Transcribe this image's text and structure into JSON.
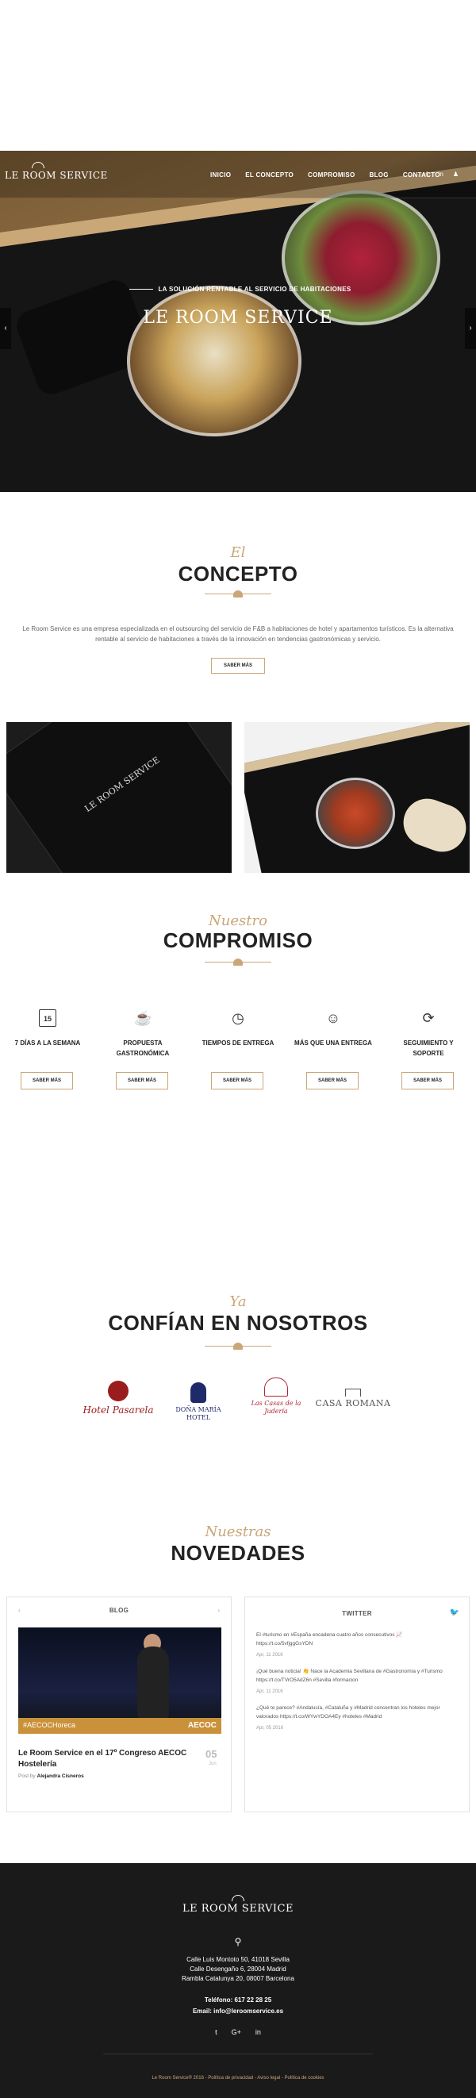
{
  "nav": {
    "logo": "LE ROOM SERVICE",
    "menu": [
      "INICIO",
      "EL CONCEPTO",
      "COMPROMISO",
      "BLOG",
      "CONTACTO"
    ]
  },
  "hero": {
    "subtitle": "LA SOLUCIÓN RENTABLE AL SERVICIO DE HABITACIONES",
    "title": "LE ROOM SERVICE"
  },
  "concepto": {
    "script": "El",
    "title": "CONCEPTO",
    "text": "Le Room Service es una empresa especializada en el outsourcing del servicio de F&B a habitaciones de hotel y apartamentos turísticos. Es la alternativa rentable al servicio de habitaciones a través de la innovación en tendencias gastronómicas y servicio.",
    "button": "SABER MÁS"
  },
  "photos": {
    "left_text": "LE ROOM SERVICE"
  },
  "compromiso": {
    "script": "Nuestro",
    "title": "COMPROMISO",
    "items": [
      {
        "label": "7 DÍAS A LA SEMANA",
        "icon": "calendar-icon",
        "glyph": "15",
        "button": "SABER MÁS"
      },
      {
        "label": "PROPUESTA GASTRONÓMICA",
        "icon": "coffee-icon",
        "glyph": "☕",
        "button": "SABER MÁS"
      },
      {
        "label": "TIEMPOS DE ENTREGA",
        "icon": "clock-icon",
        "glyph": "◷",
        "button": "SABER MÁS"
      },
      {
        "label": "MÁS QUE UNA ENTREGA",
        "icon": "smile-icon",
        "glyph": "☺",
        "button": "SABER MÁS"
      },
      {
        "label": "SEGUIMIENTO Y SOPORTE",
        "icon": "refresh-icon",
        "glyph": "⟳",
        "button": "SABER MÁS"
      }
    ]
  },
  "confian": {
    "script": "Ya",
    "title": "CONFÍAN EN NOSOTROS",
    "logos": [
      {
        "name": "Hotel Pasarela",
        "color": "#9b1c1c"
      },
      {
        "name": "DOÑA MARÍA HOTEL",
        "color": "#1f2a6b"
      },
      {
        "name": "Las Casas de la Judería",
        "color": "#b1243a"
      },
      {
        "name": "CASA ROMANA",
        "color": "#555555"
      }
    ]
  },
  "novedades": {
    "script": "Nuestras",
    "title": "NOVEDADES",
    "blog": {
      "header": "BLOG",
      "img_left": "#AECOCHoreca",
      "img_right": "AECOC",
      "post_title": "Le Room Service en el 17º Congreso AECOC Hostelería",
      "by_label": "Post by",
      "author": "Alejandra Cisneros",
      "day": "05",
      "month": "Jun"
    },
    "twitter": {
      "header": "TWITTER",
      "tweets": [
        {
          "text": "El #turismo en #España encadena cuatro años consecutivos 📈 https://t.co/5vfjggGsYDN",
          "date": "Apr, 11 2016"
        },
        {
          "text": "¡Qué buena noticia! 👏 Nace la Academia Sevillana de #Gastronomía y #Turismo https://t.co/TVrO5AdZ6n #Sevilla #formacion",
          "date": "Apr, 11 2016"
        },
        {
          "text": "¿Qué te parece? #Andalucía, #Cataluña y #Madrid concentran los hoteles mejor valorados https://t.co/WYwYDOA4Ey #hoteles #Madrid",
          "date": "Apr, 05 2016"
        }
      ]
    }
  },
  "footer": {
    "logo": "LE ROOM SERVICE",
    "addresses": [
      "Calle Luis Montoto 50, 41018 Sevilla",
      "Calle Desengaño 6, 28004 Madrid",
      "Rambla Catalunya 20, 08007 Barcelona"
    ],
    "phone": "Teléfono: 617 22 28 25",
    "email": "Email: info@leroomservice.es",
    "social": [
      "t",
      "G+",
      "in"
    ],
    "bottom": "Le Room Service® 2016 - Política de privacidad - Aviso legal - Política de cookies"
  },
  "colors": {
    "accent": "#c9a777",
    "dark": "#1a1a1a"
  }
}
